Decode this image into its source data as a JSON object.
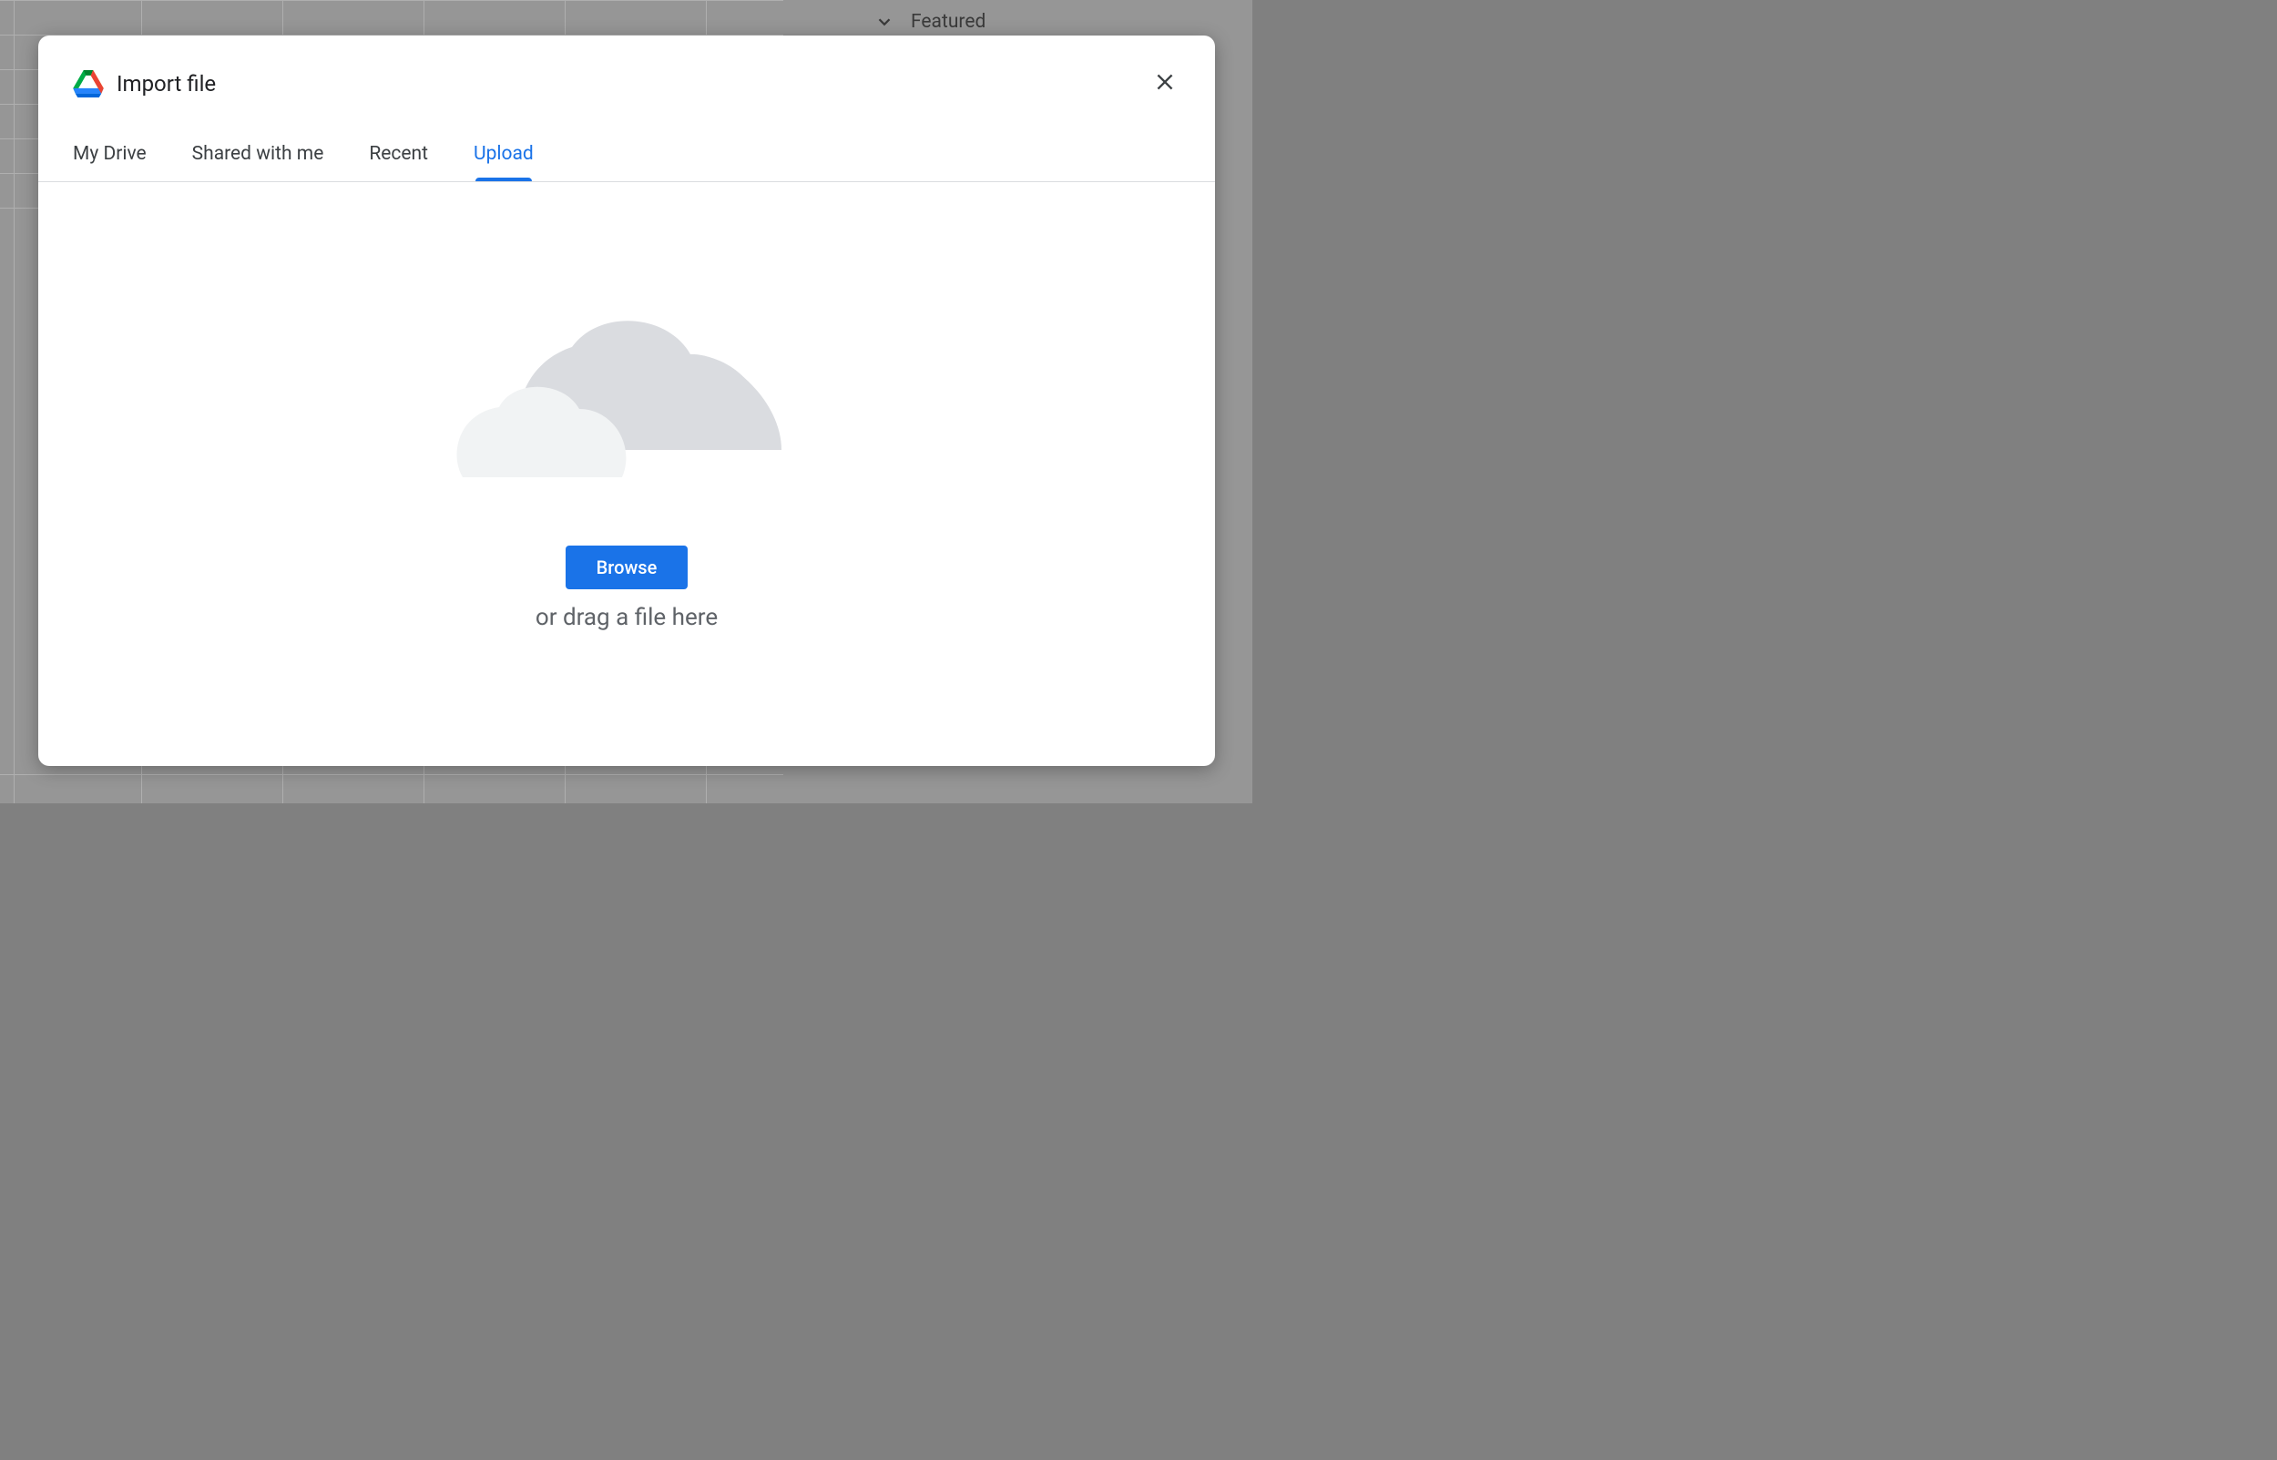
{
  "background": {
    "sidebar": {
      "featured_label": "Featured"
    }
  },
  "modal": {
    "title": "Import file",
    "tabs": [
      {
        "label": "My Drive",
        "active": false
      },
      {
        "label": "Shared with me",
        "active": false
      },
      {
        "label": "Recent",
        "active": false
      },
      {
        "label": "Upload",
        "active": true
      }
    ],
    "upload": {
      "browse_button": "Browse",
      "drag_text": "or drag a file here"
    },
    "icons": {
      "drive_logo": "google-drive-logo",
      "close": "close-icon",
      "cloud": "cloud-upload-illustration"
    },
    "colors": {
      "primary": "#1a73e8",
      "text": "#3c4043",
      "text_secondary": "#5f6368"
    }
  }
}
